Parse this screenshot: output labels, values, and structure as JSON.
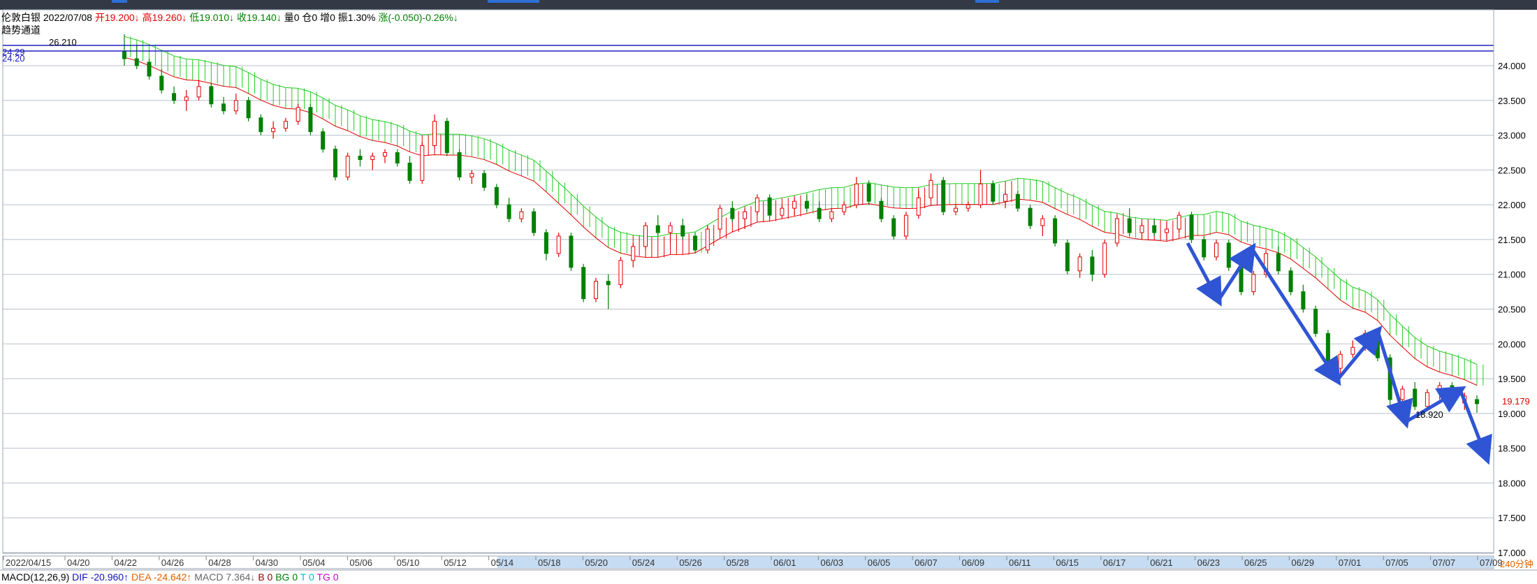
{
  "header": {
    "instrument": "伦敦白银",
    "date": "2022/07/08",
    "open": "开19.200↓",
    "high": "高19.260↓",
    "low": "低19.010↓",
    "close": "收19.140↓",
    "volume": "量0",
    "position": "仓0",
    "increase": "增0",
    "amplitude": "振1.30%",
    "change": "涨(-0.050)-0.26%↓"
  },
  "indicator_name": "趋势通道",
  "price_axis": {
    "ticks": [
      "17.000",
      "17.500",
      "18.000",
      "18.500",
      "19.000",
      "19.500",
      "20.000",
      "20.500",
      "21.000",
      "21.500",
      "22.000",
      "22.500",
      "23.000",
      "23.500",
      "24.000"
    ],
    "last_price": "19.179",
    "period": "240分钟"
  },
  "date_axis": {
    "labels": [
      "2022/04/15",
      "04/20",
      "04/22",
      "04/26",
      "04/28",
      "04/30",
      "05/04",
      "05/06",
      "05/10",
      "05/12",
      "05/14",
      "05/18",
      "05/20",
      "05/24",
      "05/26",
      "05/28",
      "06/01",
      "06/03",
      "06/05",
      "06/07",
      "06/09",
      "06/11",
      "06/15",
      "06/17",
      "06/21",
      "06/23",
      "06/25",
      "06/29",
      "07/01",
      "07/05",
      "07/07",
      "07/09"
    ]
  },
  "channel_lines": {
    "upper": "24.29",
    "lower": "24.20"
  },
  "annotations": {
    "high_label": "26.210",
    "low_label": "18.920"
  },
  "macd": {
    "name": "MACD(12,26,9)",
    "dif": "DIF -20.960↑",
    "dea": "DEA -24.642↑",
    "macd": "MACD 7.364↓",
    "b": "B 0",
    "bg": "BG 0",
    "t": "T 0",
    "tg": "TG 0"
  },
  "colors": {
    "up": "#e00000",
    "down": "#008000",
    "channel_fill": "#7fff7f",
    "channel_up": "#e00000",
    "arrow": "#2f55d4",
    "hline": "#2020c0",
    "grid": "#b8c0cc"
  },
  "chart_data": {
    "type": "candlestick",
    "title": "伦敦白银",
    "ylim": [
      17.0,
      24.3
    ],
    "candles": [
      [
        24.2,
        24.45,
        24.0,
        24.1
      ],
      [
        24.1,
        24.3,
        23.95,
        24.0
      ],
      [
        24.05,
        24.1,
        23.8,
        23.85
      ],
      [
        23.85,
        23.95,
        23.6,
        23.65
      ],
      [
        23.6,
        23.7,
        23.45,
        23.5
      ],
      [
        23.5,
        23.65,
        23.35,
        23.55
      ],
      [
        23.55,
        23.8,
        23.5,
        23.7
      ],
      [
        23.7,
        23.75,
        23.4,
        23.45
      ],
      [
        23.45,
        23.55,
        23.3,
        23.35
      ],
      [
        23.35,
        23.6,
        23.3,
        23.5
      ],
      [
        23.5,
        23.55,
        23.2,
        23.25
      ],
      [
        23.25,
        23.3,
        23.0,
        23.05
      ],
      [
        23.05,
        23.2,
        22.95,
        23.1
      ],
      [
        23.1,
        23.25,
        23.05,
        23.2
      ],
      [
        23.2,
        23.45,
        23.15,
        23.4
      ],
      [
        23.4,
        23.45,
        23.0,
        23.05
      ],
      [
        23.05,
        23.1,
        22.75,
        22.8
      ],
      [
        22.8,
        22.85,
        22.35,
        22.4
      ],
      [
        22.4,
        22.75,
        22.35,
        22.7
      ],
      [
        22.7,
        22.8,
        22.55,
        22.65
      ],
      [
        22.65,
        22.75,
        22.5,
        22.7
      ],
      [
        22.7,
        22.8,
        22.6,
        22.75
      ],
      [
        22.75,
        22.8,
        22.55,
        22.6
      ],
      [
        22.6,
        22.7,
        22.3,
        22.35
      ],
      [
        22.35,
        22.9,
        22.3,
        22.85
      ],
      [
        22.85,
        23.3,
        22.8,
        23.2
      ],
      [
        23.2,
        23.25,
        22.7,
        22.75
      ],
      [
        22.75,
        22.8,
        22.35,
        22.4
      ],
      [
        22.4,
        22.5,
        22.3,
        22.45
      ],
      [
        22.45,
        22.5,
        22.2,
        22.25
      ],
      [
        22.25,
        22.3,
        21.95,
        22.0
      ],
      [
        22.0,
        22.1,
        21.75,
        21.8
      ],
      [
        21.8,
        21.95,
        21.75,
        21.9
      ],
      [
        21.9,
        21.95,
        21.55,
        21.6
      ],
      [
        21.6,
        21.65,
        21.2,
        21.3
      ],
      [
        21.3,
        21.6,
        21.25,
        21.55
      ],
      [
        21.55,
        21.6,
        21.05,
        21.1
      ],
      [
        21.1,
        21.15,
        20.6,
        20.65
      ],
      [
        20.65,
        20.95,
        20.6,
        20.9
      ],
      [
        20.9,
        21.0,
        20.5,
        20.85
      ],
      [
        20.85,
        21.25,
        20.8,
        21.2
      ],
      [
        21.2,
        21.45,
        21.1,
        21.4
      ],
      [
        21.4,
        21.75,
        21.35,
        21.7
      ],
      [
        21.7,
        21.85,
        21.55,
        21.6
      ],
      [
        21.6,
        21.75,
        21.45,
        21.7
      ],
      [
        21.7,
        21.8,
        21.5,
        21.55
      ],
      [
        21.55,
        21.6,
        21.3,
        21.35
      ],
      [
        21.35,
        21.7,
        21.3,
        21.65
      ],
      [
        21.65,
        22.0,
        21.6,
        21.95
      ],
      [
        21.95,
        22.05,
        21.75,
        21.8
      ],
      [
        21.8,
        21.95,
        21.65,
        21.9
      ],
      [
        21.9,
        22.15,
        21.85,
        22.1
      ],
      [
        22.1,
        22.15,
        21.8,
        21.85
      ],
      [
        21.85,
        22.0,
        21.8,
        21.95
      ],
      [
        21.95,
        22.1,
        21.85,
        22.05
      ],
      [
        22.05,
        22.15,
        21.9,
        21.95
      ],
      [
        21.95,
        22.05,
        21.75,
        21.8
      ],
      [
        21.8,
        21.95,
        21.75,
        21.9
      ],
      [
        21.9,
        22.05,
        21.85,
        22.0
      ],
      [
        22.0,
        22.4,
        21.95,
        22.3
      ],
      [
        22.3,
        22.35,
        22.0,
        22.05
      ],
      [
        22.05,
        22.1,
        21.75,
        21.8
      ],
      [
        21.8,
        21.85,
        21.5,
        21.55
      ],
      [
        21.55,
        21.9,
        21.5,
        21.85
      ],
      [
        21.85,
        22.2,
        21.8,
        22.1
      ],
      [
        22.1,
        22.45,
        22.05,
        22.35
      ],
      [
        22.35,
        22.4,
        21.85,
        21.9
      ],
      [
        21.9,
        22.0,
        21.85,
        21.95
      ],
      [
        21.95,
        22.05,
        21.9,
        22.0
      ],
      [
        22.0,
        22.5,
        21.95,
        22.3
      ],
      [
        22.3,
        22.35,
        22.0,
        22.05
      ],
      [
        22.05,
        22.2,
        21.95,
        22.15
      ],
      [
        22.15,
        22.2,
        21.9,
        21.95
      ],
      [
        21.95,
        22.0,
        21.65,
        21.7
      ],
      [
        21.7,
        21.85,
        21.55,
        21.8
      ],
      [
        21.8,
        21.85,
        21.4,
        21.45
      ],
      [
        21.45,
        21.5,
        21.0,
        21.05
      ],
      [
        21.05,
        21.3,
        20.95,
        21.25
      ],
      [
        21.25,
        21.35,
        20.9,
        21.0
      ],
      [
        21.0,
        21.5,
        20.95,
        21.45
      ],
      [
        21.45,
        21.85,
        21.4,
        21.8
      ],
      [
        21.8,
        21.95,
        21.55,
        21.6
      ],
      [
        21.6,
        21.75,
        21.5,
        21.7
      ],
      [
        21.7,
        21.8,
        21.55,
        21.6
      ],
      [
        21.6,
        21.75,
        21.5,
        21.65
      ],
      [
        21.65,
        21.9,
        21.6,
        21.85
      ],
      [
        21.85,
        21.9,
        21.45,
        21.5
      ],
      [
        21.5,
        21.55,
        21.2,
        21.25
      ],
      [
        21.25,
        21.5,
        21.2,
        21.45
      ],
      [
        21.45,
        21.5,
        21.05,
        21.1
      ],
      [
        21.1,
        21.2,
        20.7,
        20.75
      ],
      [
        20.75,
        21.05,
        20.7,
        21.0
      ],
      [
        21.0,
        21.35,
        20.95,
        21.3
      ],
      [
        21.3,
        21.4,
        21.0,
        21.05
      ],
      [
        21.05,
        21.1,
        20.7,
        20.75
      ],
      [
        20.75,
        20.85,
        20.45,
        20.5
      ],
      [
        20.5,
        20.55,
        20.1,
        20.15
      ],
      [
        20.15,
        20.2,
        19.6,
        19.65
      ],
      [
        19.65,
        19.9,
        19.5,
        19.85
      ],
      [
        19.85,
        20.05,
        19.8,
        19.95
      ],
      [
        19.95,
        20.2,
        19.9,
        20.15
      ],
      [
        20.15,
        20.2,
        19.75,
        19.8
      ],
      [
        19.8,
        19.85,
        19.1,
        19.2
      ],
      [
        19.2,
        19.4,
        18.92,
        19.35
      ],
      [
        19.35,
        19.45,
        19.05,
        19.1
      ],
      [
        19.1,
        19.35,
        19.05,
        19.3
      ],
      [
        19.3,
        19.45,
        19.2,
        19.4
      ],
      [
        19.4,
        19.45,
        19.1,
        19.15
      ],
      [
        19.15,
        19.3,
        19.05,
        19.25
      ],
      [
        19.2,
        19.26,
        19.01,
        19.14
      ]
    ],
    "last_price": 19.179
  }
}
